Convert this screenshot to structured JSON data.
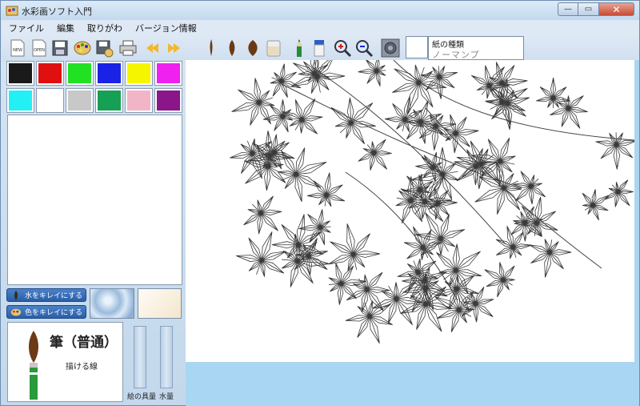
{
  "window": {
    "title": "水彩画ソフト入門",
    "controls": {
      "minimize": "—",
      "maximize": "▭",
      "close": "✕"
    }
  },
  "menu": [
    "ファイル",
    "編集",
    "取りがわ",
    "バージョン情報"
  ],
  "toolbar": {
    "new_label": "NEW",
    "open_label": "OPEN",
    "icons": [
      "new-icon",
      "open-icon",
      "save-icon",
      "palette-icon",
      "save-as-icon",
      "print-icon",
      "undo-icon",
      "redo-icon",
      "brush-thin-icon",
      "brush-medium-icon",
      "brush-wide-icon",
      "water-cup-icon",
      "pencil-icon",
      "eraser-icon",
      "zoom-in-icon",
      "zoom-out-icon",
      "settings-icon"
    ]
  },
  "status": {
    "line1": "紙の種類",
    "line2": "ノーマンプ"
  },
  "palette": [
    "#1a1a1a",
    "#e01010",
    "#22e022",
    "#1a22e6",
    "#f5f500",
    "#f020f0",
    "#22f0f5",
    "#ffffff",
    "#c8c8c8",
    "#16a055",
    "#f2b5c8",
    "#8a168a"
  ],
  "actions": [
    {
      "label": "水をキレイにする",
      "icon": "brush-wash-icon"
    },
    {
      "label": "色をキレイにする",
      "icon": "palette-wash-icon"
    }
  ],
  "brush": {
    "name": "筆（普通）",
    "description": "描ける線"
  },
  "sliders": {
    "paint_label": "絵の具量",
    "water_label": "水量"
  },
  "colors": {
    "canvas_bg": "#a9d6f2",
    "accent": "#2a5ea8"
  }
}
